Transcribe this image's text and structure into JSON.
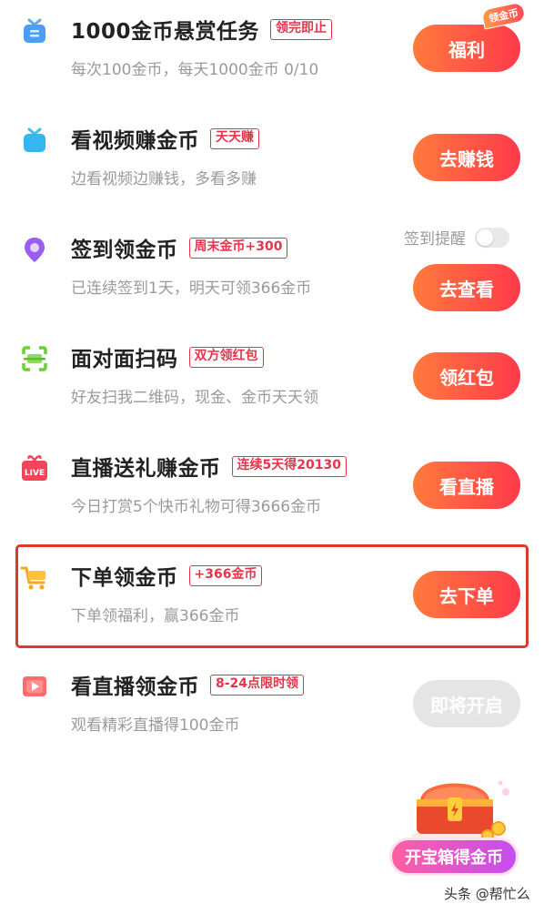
{
  "tasks": [
    {
      "title": "1000金币悬赏任务",
      "tag": "领完即止",
      "desc": "每次100金币，每天1000金币 0/10",
      "button": "福利",
      "corner_badge": "领金币"
    },
    {
      "title": "看视频赚金币",
      "tag": "天天赚",
      "desc": "边看视频边赚钱，多看多赚",
      "button": "去赚钱"
    },
    {
      "title": "签到领金币",
      "tag": "周末金币+300",
      "desc": "已连续签到1天，明天可领366金币",
      "button": "去查看",
      "reminder_label": "签到提醒"
    },
    {
      "title": "面对面扫码",
      "tag": "双方领红包",
      "desc": "好友扫我二维码，现金、金币天天领",
      "button": "领红包"
    },
    {
      "title": "直播送礼赚金币",
      "tag": "连续5天得20130",
      "desc": "今日打赏5个快币礼物可得3666金币",
      "button": "看直播",
      "icon_text": "LIVE"
    },
    {
      "title": "下单领金币",
      "tag": "+366金币",
      "desc": "下单领福利，赢366金币",
      "button": "去下单"
    },
    {
      "title": "看直播领金币",
      "tag": "8-24点限时领",
      "desc": "观看精彩直播得100金币",
      "button": "即将开启"
    }
  ],
  "icons": [
    "tv-icon",
    "tv-icon",
    "location-pin-icon",
    "scan-icon",
    "live-gift-icon",
    "shopping-cart-icon",
    "play-video-icon"
  ],
  "reminder_toggle": false,
  "chest": {
    "button_label": "开宝箱得金币"
  },
  "watermark": "头条 @帮忙么",
  "colors": {
    "accent": "#ff4a45",
    "tag": "#e8334a",
    "highlight_border": "#d83a2c",
    "disabled": "#e5e5e5"
  }
}
